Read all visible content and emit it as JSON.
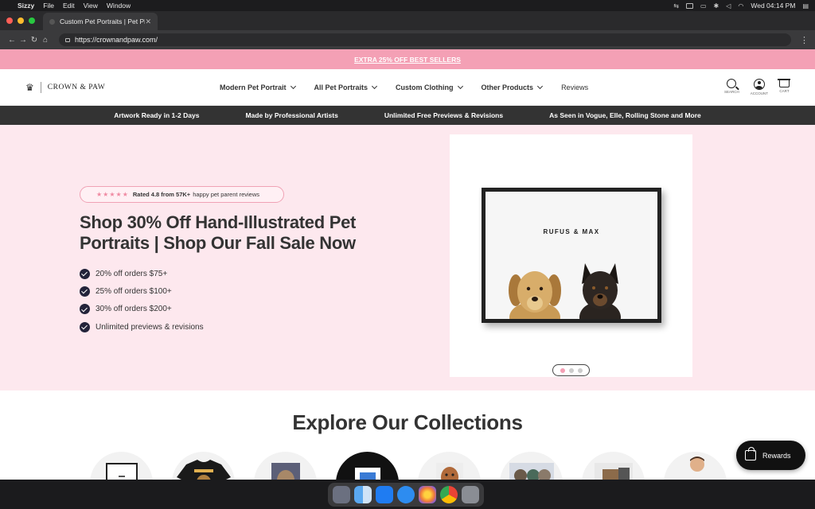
{
  "menubar": {
    "app_name": "Sizzy",
    "menus": [
      "File",
      "Edit",
      "View",
      "Window"
    ],
    "clock": "Wed 04:14 PM"
  },
  "browser": {
    "tab_title": "Custom Pet Portraits | Pet Pict",
    "url": "https://crownandpaw.com/"
  },
  "promo": {
    "text": "EXTRA 25% OFF BEST SELLERS"
  },
  "header": {
    "logo_text": "CROWN & PAW",
    "nav": [
      {
        "label": "Modern Pet Portrait"
      },
      {
        "label": "All Pet Portraits"
      },
      {
        "label": "Custom Clothing"
      },
      {
        "label": "Other Products"
      },
      {
        "label": "Reviews"
      }
    ],
    "icons": [
      {
        "name": "search-icon",
        "label": "SEARCH"
      },
      {
        "name": "account-icon",
        "label": "ACCOUNT"
      },
      {
        "name": "cart-icon",
        "label": "CART"
      }
    ]
  },
  "usps": [
    "Artwork Ready in 1-2 Days",
    "Made by Professional Artists",
    "Unlimited Free Previews & Revisions",
    "As Seen in Vogue, Elle, Rolling Stone and More"
  ],
  "hero": {
    "rating": {
      "stars": "★★★★★",
      "bold": "Rated 4.8 from 57K+",
      "rest": "happy pet parent reviews"
    },
    "title": "Shop 30% Off Hand-Illustrated Pet Portraits | Shop Our Fall Sale Now",
    "perks": [
      "20% off orders $75+",
      "25% off orders $100+",
      "30% off orders $200+",
      "Unlimited previews & revisions"
    ],
    "portrait_text": "RUFUS & MAX",
    "carousel": {
      "count": 3,
      "active": 1
    }
  },
  "collections": {
    "title": "Explore Our Collections"
  },
  "rewards": {
    "label": "Rewards"
  },
  "colors": {
    "promo_pink": "#f4a0b5",
    "hero_bg": "#fde8ee",
    "usp_bar": "#333333",
    "check_navy": "#23233a"
  }
}
